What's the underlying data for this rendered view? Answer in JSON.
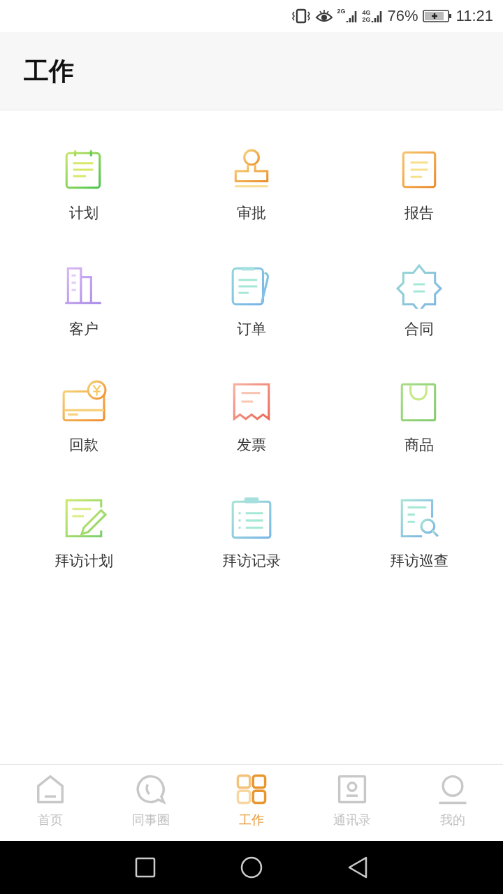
{
  "status_bar": {
    "network_1": "2G",
    "network_2": "4G",
    "network_3": "2G",
    "battery": "76%",
    "time": "11:21"
  },
  "header": {
    "title": "工作"
  },
  "apps": [
    {
      "label": "计划"
    },
    {
      "label": "审批"
    },
    {
      "label": "报告"
    },
    {
      "label": "客户"
    },
    {
      "label": "订单"
    },
    {
      "label": "合同"
    },
    {
      "label": "回款"
    },
    {
      "label": "发票"
    },
    {
      "label": "商品"
    },
    {
      "label": "拜访计划"
    },
    {
      "label": "拜访记录"
    },
    {
      "label": "拜访巡查"
    }
  ],
  "tab_bar": [
    {
      "label": "首页",
      "selected": false
    },
    {
      "label": "同事圈",
      "selected": false
    },
    {
      "label": "工作",
      "selected": true
    },
    {
      "label": "通讯录",
      "selected": false
    },
    {
      "label": "我的",
      "selected": false
    }
  ]
}
